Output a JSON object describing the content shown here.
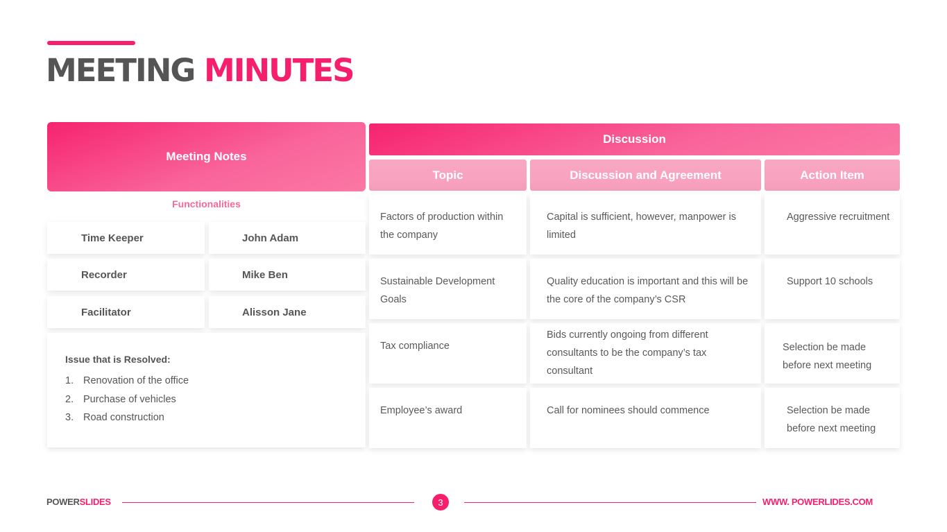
{
  "title": {
    "part1": "MEETING",
    "part2": "MINUTES"
  },
  "colors": {
    "accent": "#f61f6d",
    "text": "#555555",
    "subheader": "#f9a7c3",
    "functionalities": "#f26a97"
  },
  "meeting_notes": {
    "header": "Meeting Notes",
    "subtitle": "Functionalities",
    "roles": [
      {
        "role": "Time Keeper",
        "name": "John Adam"
      },
      {
        "role": "Recorder",
        "name": "Mike Ben"
      },
      {
        "role": "Facilitator",
        "name": "Alisson Jane"
      }
    ],
    "issues_title": "Issue that is Resolved:",
    "issues": [
      {
        "num": "1.",
        "text": "Renovation of the office"
      },
      {
        "num": "2.",
        "text": "Purchase of vehicles"
      },
      {
        "num": "3.",
        "text": "Road construction"
      }
    ]
  },
  "discussion": {
    "header": "Discussion",
    "columns": [
      "Topic",
      "Discussion and Agreement",
      "Action Item"
    ],
    "rows": [
      {
        "topic": "Factors of production within the company",
        "agreement": "Capital is sufficient, however, manpower is limited",
        "action": "Aggressive recruitment"
      },
      {
        "topic": "Sustainable Development Goals",
        "agreement": "Quality education is important and this will be the core of the company’s CSR",
        "action": "Support 10 schools"
      },
      {
        "topic": "Tax compliance",
        "agreement": "Bids currently ongoing from different consultants to be the company’s tax consultant",
        "action": "Selection be made before next meeting"
      },
      {
        "topic": "Employee’s award",
        "agreement": "Call for nominees should commence",
        "action": "Selection be made before next meeting"
      }
    ]
  },
  "footer": {
    "brand_part1": "POWER",
    "brand_part2": "SLIDES",
    "page_number": "3",
    "url": "WWW. POWERLIDES.COM"
  }
}
